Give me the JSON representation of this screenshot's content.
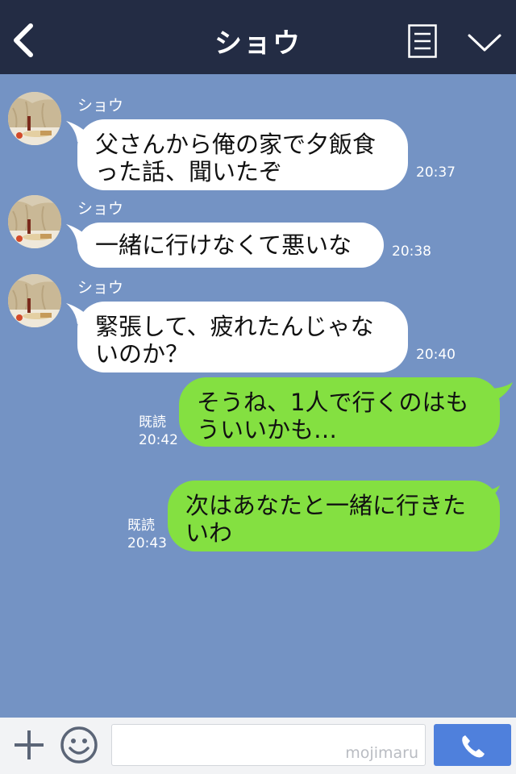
{
  "header": {
    "title": "ショウ",
    "back_icon": "chevron-left-icon",
    "memo_icon": "note-icon",
    "menu_icon": "chevron-down-icon",
    "bg_color": "#232c44"
  },
  "chat": {
    "bg_color": "#7493c4",
    "messages": [
      {
        "sender": "ショウ",
        "text": "父さんから俺の家で夕飯食\nった話、聞いたぞ",
        "time": "20:37",
        "direction": "in"
      },
      {
        "sender": "ショウ",
        "text": "一緒に行けなくて悪いな",
        "time": "20:38",
        "direction": "in"
      },
      {
        "sender": "ショウ",
        "text": "緊張して、疲れたんじゃな\nいのか？",
        "time": "20:40",
        "direction": "in"
      },
      {
        "text": "そうね、1人で行くのはも\nういいかも…",
        "read": "既読",
        "time": "20:42",
        "direction": "out"
      },
      {
        "text": "次はあなたと一緒に行きた\nいわ",
        "read": "既読",
        "time": "20:43",
        "direction": "out"
      }
    ]
  },
  "footer": {
    "plus_icon": "plus-icon",
    "emoji_icon": "smiley-icon",
    "input_value": "",
    "watermark": "mojimaru",
    "call_icon": "phone-icon",
    "call_color": "#4f80dc"
  }
}
